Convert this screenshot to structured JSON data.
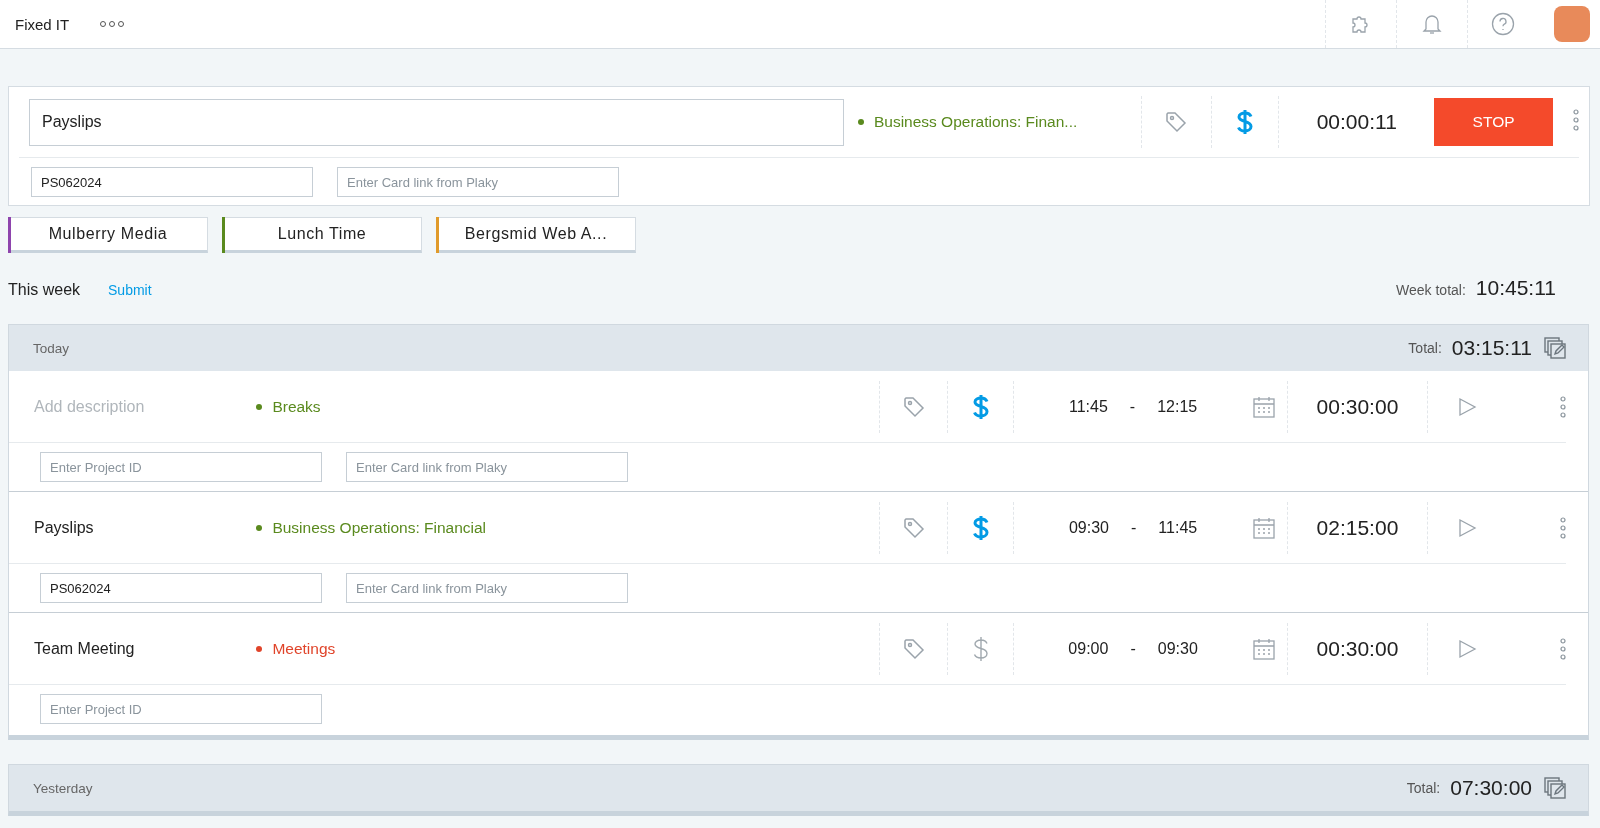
{
  "topbar": {
    "workspace": "Fixed IT"
  },
  "timer": {
    "description": "Payslips",
    "project": {
      "name": "Business Operations: Finan...",
      "color": "#5a8a1e"
    },
    "billable": true,
    "elapsed": "00:00:11",
    "stop_label": "STOP",
    "fields": [
      {
        "value": "PS062024"
      },
      {
        "placeholder": "Enter Card link from Plaky"
      }
    ]
  },
  "quick_entries": [
    {
      "label": "Mulberry Media",
      "color": "#8e44ad"
    },
    {
      "label": "Lunch Time",
      "color": "#5a8a1e"
    },
    {
      "label": "Bergsmid Web A...",
      "color": "#e09a2a"
    }
  ],
  "week": {
    "label": "This week",
    "submit": "Submit",
    "total_label": "Week total:",
    "total": "10:45:11"
  },
  "groups": [
    {
      "label": "Today",
      "total_label": "Total:",
      "total": "03:15:11",
      "entries": [
        {
          "placeholder": "Add description",
          "project": {
            "name": "Breaks",
            "color": "#5a8a1e"
          },
          "billable": true,
          "start": "11:45",
          "separator": "-",
          "end": "12:15",
          "duration": "00:30:00",
          "fields": [
            {
              "placeholder": "Enter Project ID"
            },
            {
              "placeholder": "Enter Card link from Plaky"
            }
          ]
        },
        {
          "description": "Payslips",
          "project": {
            "name": "Business Operations: Financial",
            "color": "#5a8a1e"
          },
          "billable": true,
          "start": "09:30",
          "separator": "-",
          "end": "11:45",
          "duration": "02:15:00",
          "fields": [
            {
              "value": "PS062024"
            },
            {
              "placeholder": "Enter Card link from Plaky"
            }
          ]
        },
        {
          "description": "Team Meeting",
          "project": {
            "name": "Meetings",
            "color": "#e0442a"
          },
          "billable": false,
          "start": "09:00",
          "separator": "-",
          "end": "09:30",
          "duration": "00:30:00",
          "fields": [
            {
              "placeholder": "Enter Project ID"
            }
          ]
        }
      ]
    },
    {
      "label": "Yesterday",
      "total_label": "Total:",
      "total": "07:30:00"
    }
  ]
}
